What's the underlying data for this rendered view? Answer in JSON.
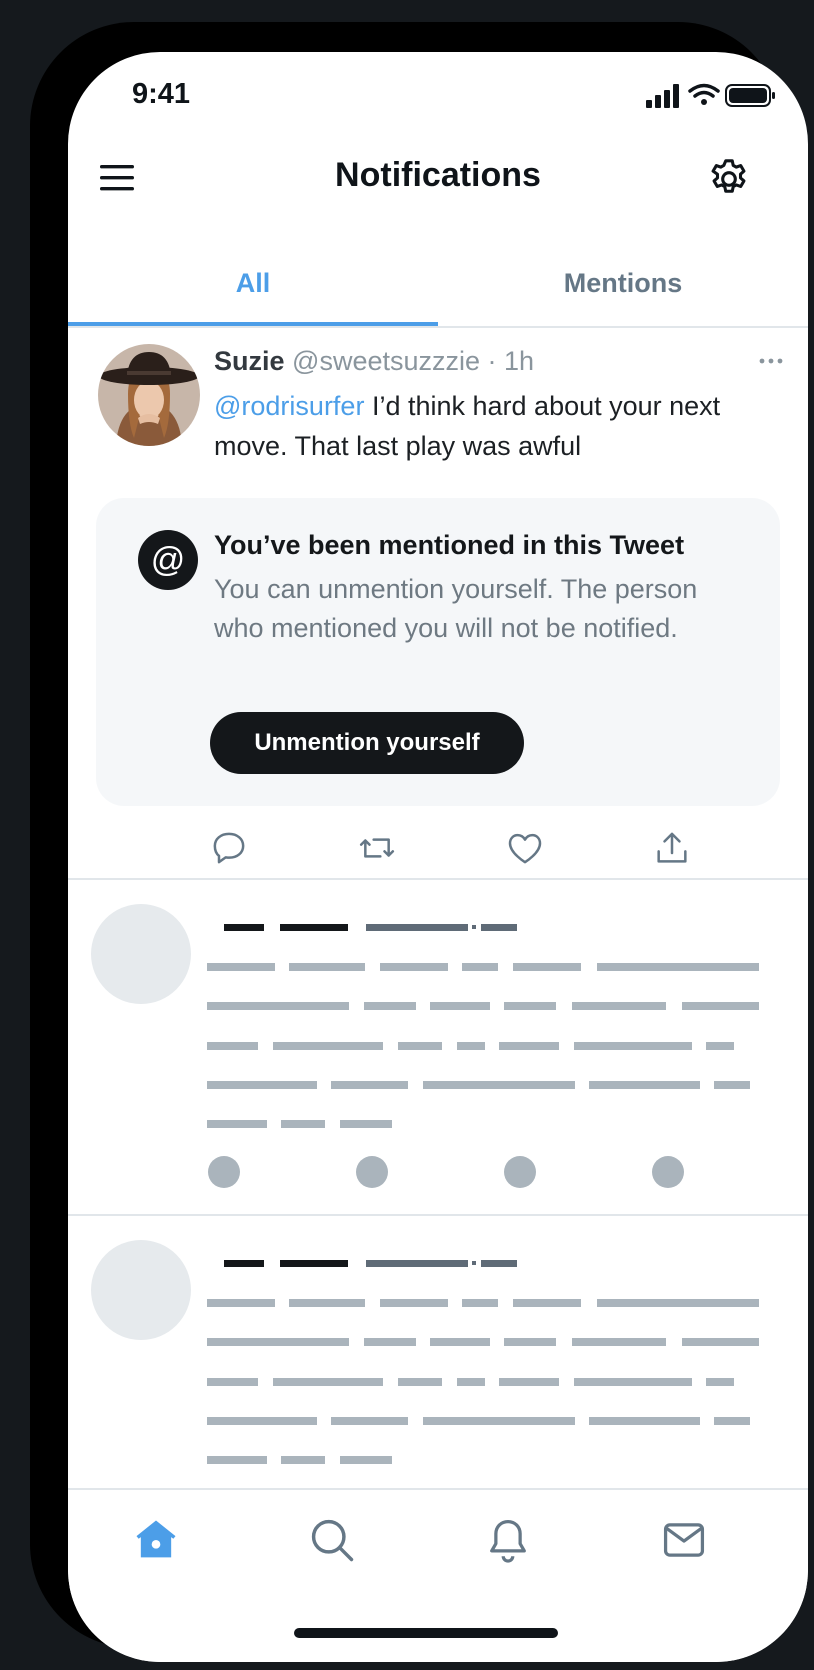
{
  "status_bar": {
    "time": "9:41"
  },
  "header": {
    "title": "Notifications"
  },
  "tabs": [
    {
      "label": "All",
      "active": true
    },
    {
      "label": "Mentions",
      "active": false
    }
  ],
  "tweet": {
    "name": "Suzie",
    "meta": "@sweetsuzzzie · 1h",
    "mention": "@rodrisurfer",
    "text": " I’d think hard about your next move. That last play was awful"
  },
  "mention_card": {
    "title": "You’ve been mentioned in this Tweet",
    "text": "You can unmention yourself. The person who mentioned you will not be notified.",
    "button_label": "Unmention yourself",
    "icon_glyph": "@"
  },
  "tweet_actions": [
    "reply-icon",
    "retweet-icon",
    "like-icon",
    "share-icon"
  ],
  "bottom_nav": [
    "home-icon",
    "search-icon",
    "notifications-icon",
    "messages-icon"
  ],
  "colors": {
    "accent": "#4c9ee8",
    "text_primary": "#0f1419",
    "text_secondary": "#657786",
    "skeleton": "#aab4bc"
  }
}
